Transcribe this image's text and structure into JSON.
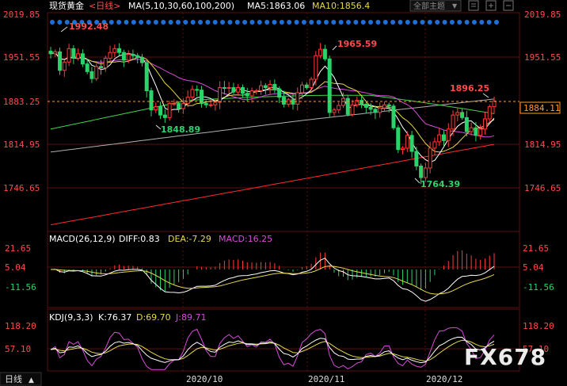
{
  "header": {
    "title": "现货黄金",
    "period_selector": "<日线>",
    "ma_legend": "MA(5,10,30,60,100,200)",
    "ma5_label": "MA5:1863.06",
    "ma10_label": "MA10:1856.4",
    "theme_selector": "全部主题",
    "theme_arrow": "▼"
  },
  "colors": {
    "background": "#000000",
    "up": "#ff3b3b",
    "down": "#2bd46a",
    "ma5": "#ffffff",
    "ma10": "#e6d84a",
    "ma30": "#d84bd8",
    "ma60": "#3fd64a",
    "ma100": "#b0b0b0",
    "ma200": "#ff2a2a",
    "axis_text": "#ff4a4a",
    "dashed_price": "#ff9a2a",
    "event_dots": "#1e6fd8"
  },
  "price_axis": {
    "ticks": [
      "2019.85",
      "1951.55",
      "1883.25",
      "1814.95",
      "1746.65"
    ],
    "current_price": "1884.11"
  },
  "annotations": {
    "high_1": "1992.48",
    "high_2": "1965.59",
    "high_3": "1896.25",
    "low_1": "1848.89",
    "low_2": "1764.39"
  },
  "macd": {
    "label": "MACD(26,12,9)",
    "diff": "DIFF:0.83",
    "dea": "DEA:-7.29",
    "macd": "MACD:16.25",
    "ticks": [
      "21.65",
      "5.04",
      "-11.56"
    ]
  },
  "kdj": {
    "label": "KDJ(9,3,3)",
    "k": "K:76.37",
    "d": "D:69.70",
    "j": "J:89.71",
    "ticks": [
      "118.20",
      "57.10"
    ]
  },
  "time_axis": {
    "period": "日线",
    "period_arrow": "▲",
    "labels": [
      "2020/10",
      "2020/11",
      "2020/12"
    ]
  },
  "watermark": "FX678",
  "chart_data": {
    "type": "candlestick",
    "y_range": [
      1700,
      2040
    ],
    "closes": [
      1958,
      1961,
      1932,
      1945,
      1966,
      1951,
      1958,
      1942,
      1930,
      1919,
      1938,
      1936,
      1951,
      1960,
      1966,
      1960,
      1948,
      1957,
      1955,
      1952,
      1944,
      1900,
      1870,
      1875,
      1862,
      1858,
      1880,
      1880,
      1872,
      1880,
      1890,
      1902,
      1901,
      1880,
      1878,
      1878,
      1882,
      1905,
      1904,
      1905,
      1898,
      1905,
      1896,
      1892,
      1900,
      1900,
      1908,
      1905,
      1910,
      1903,
      1890,
      1879,
      1886,
      1879,
      1897,
      1909,
      1905,
      1918,
      1955,
      1965,
      1950,
      1866,
      1870,
      1877,
      1888,
      1863,
      1878,
      1885,
      1879,
      1874,
      1871,
      1866,
      1873,
      1878,
      1876,
      1842,
      1808,
      1810,
      1830,
      1805,
      1782,
      1764,
      1779,
      1810,
      1820,
      1831,
      1822,
      1840,
      1862,
      1866,
      1858,
      1836,
      1842,
      1830,
      1840,
      1856,
      1875,
      1884
    ]
  }
}
